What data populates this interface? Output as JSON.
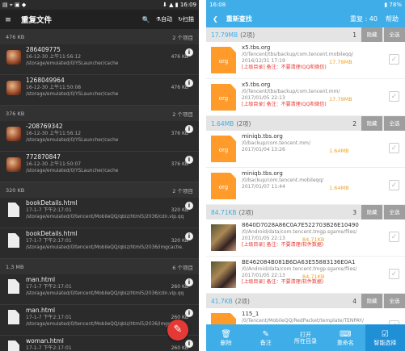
{
  "left": {
    "status": {
      "left": "▤ ⌖ ▣ ◆",
      "right": "⬇ ▲ ▮ 16:09"
    },
    "toolbar": {
      "title": "重复文件",
      "search": "🔍",
      "auto": "自动",
      "scan": "扫描",
      "menu": "≡"
    },
    "groups": [
      {
        "size": "476 KB",
        "count": "2 个项目",
        "items": [
          {
            "name": "286409775",
            "date": "16-12-30 上午11:56:12",
            "path": "/storage/emulated/0/YSLauncher/cache",
            "size": "476 KB",
            "icon": "avatar"
          },
          {
            "name": "1268049964",
            "date": "16-12-30 上午11:50:08",
            "path": "/storage/emulated/0/YSLauncher/cache",
            "size": "476 KB",
            "icon": "avatar"
          }
        ]
      },
      {
        "size": "376 KB",
        "count": "2 个项目",
        "items": [
          {
            "name": "-208769342",
            "date": "16-12-30 上午11:56:12",
            "path": "/storage/emulated/0/YSLauncher/cache",
            "size": "376 KB",
            "icon": "avatar"
          },
          {
            "name": "772870847",
            "date": "16-12-30 上午11:50:07",
            "path": "/storage/emulated/0/YSLauncher/cache",
            "size": "376 KB",
            "icon": "avatar"
          }
        ]
      },
      {
        "size": "320 KB",
        "count": "2 个项目",
        "items": [
          {
            "name": "bookDetails.html",
            "date": "17-1-7 下午2:17:01",
            "path": "/storage/emulated/0/tencent/MobileQQ/qbiz/html5/2036/cdn.vip.qq",
            "size": "320 KB",
            "icon": "file"
          },
          {
            "name": "bookDetails.html",
            "date": "17-1-7 下午2:17:01",
            "path": "/storage/emulated/0/tencent/MobileQQ/qbiz/html5/2036/imgcache.",
            "size": "320 KB",
            "icon": "file"
          }
        ]
      },
      {
        "size": "1.3 MB",
        "count": "6 个项目",
        "items": [
          {
            "name": "man.html",
            "date": "17-1-7 下午2:17:01",
            "path": "/storage/emulated/0/tencent/MobileQQ/qbiz/html5/2036/cdn.vip.qq",
            "size": "260 KB",
            "icon": "file"
          },
          {
            "name": "man.html",
            "date": "17-1-7 下午2:17:01",
            "path": "/storage/emulated/0/tencent/MobileQQ/qbiz/html5/2036/imgcache.",
            "size": "260 KB",
            "icon": "file"
          },
          {
            "name": "woman.html",
            "date": "17-1-7 下午2:17:01",
            "path": "/storage/emulated/0/tencent/MobileQQ/qbiz/html5/2036/cdn.vip.qq",
            "size": "260 KB",
            "icon": "file"
          }
        ]
      }
    ],
    "fab": "✎"
  },
  "right": {
    "status": {
      "left": "16:08",
      "right": "▮ 78%"
    },
    "toolbar": {
      "back": "❮",
      "title": "重新查找",
      "repeat": "重复 : 40",
      "help": "帮助"
    },
    "groups": [
      {
        "size": "17.79MB",
        "count": "(2项)",
        "num": "1",
        "hide": "隐藏",
        "all": "全选",
        "items": [
          {
            "name": "x5.tbs.org",
            "path": "/0/Tencent/tbs/backup/com.tencent.mobileqq/",
            "date": "2016/12/31 17:19",
            "size": "17.79MB",
            "note": "[上级目录]  备注：不要清理(QQ和微信)",
            "icon": "org"
          },
          {
            "name": "x5.tbs.org",
            "path": "/0/Tencent/tbs/backup/com.tencent.mm/",
            "date": "2017/01/05 22:13",
            "size": "17.79MB",
            "note": "[上级目录]  备注：不要清理(QQ和微信)",
            "icon": "org"
          }
        ]
      },
      {
        "size": "1.64MB",
        "count": "(2项)",
        "num": "2",
        "hide": "隐藏",
        "all": "全选",
        "items": [
          {
            "name": "miniqb.tbs.org",
            "path": "/0/backup/com.tencent.mm/",
            "date": "2017/01/04 13:26",
            "size": "1.64MB",
            "note": "",
            "icon": "org"
          },
          {
            "name": "miniqb.tbs.org",
            "path": "/0/backup/com.tencent.mobileqq/",
            "date": "2017/01/07 11:44",
            "size": "1.64MB",
            "note": "",
            "icon": "org"
          }
        ]
      },
      {
        "size": "84.71KB",
        "count": "(2项)",
        "num": "3",
        "hide": "隐藏",
        "all": "全选",
        "items": [
          {
            "name": "8640D7028A86C0A7E522703B26E10490",
            "path": "/0/Android/data/com.tencent.tmgp.sgame/files/",
            "date": "2017/01/05 22:13",
            "size": "84.71KB",
            "note": "[上级目录]  备注：不要清理(软件数据)",
            "icon": "thumb"
          },
          {
            "name": "BE462084B081B6DA63E55883136E0A1",
            "path": "/0/Android/data/com.tencent.tmgp.sgame/files/",
            "date": "2017/01/05 22:13",
            "size": "84.71KB",
            "note": "[上级目录]  备注：不要清理(软件数据)",
            "icon": "thumb"
          }
        ]
      },
      {
        "size": "41.7KB",
        "count": "(2项)",
        "num": "4",
        "hide": "隐藏",
        "all": "全选",
        "items": [
          {
            "name": "115_1",
            "path": "/0/Tencent/MobileQQ/RedPacket/template/TENPAY/",
            "date": "",
            "size": "",
            "note": "",
            "icon": "org"
          }
        ]
      }
    ],
    "bottom": [
      {
        "icon": "🗑",
        "label": "删除"
      },
      {
        "icon": "✎",
        "label": "备注"
      },
      {
        "icon": "",
        "label": "打开\n所在目录"
      },
      {
        "icon": "⌨",
        "label": "重命名"
      },
      {
        "icon": "☑",
        "label": "智能选择"
      }
    ]
  }
}
